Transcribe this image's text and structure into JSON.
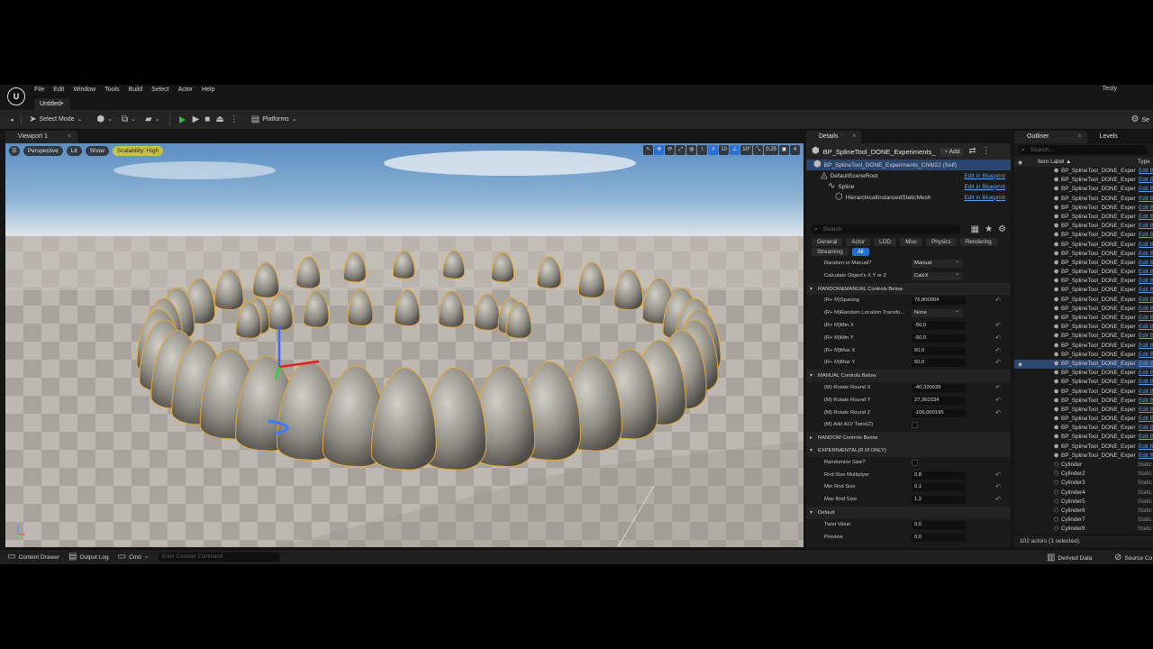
{
  "menu": {
    "items": [
      "File",
      "Edit",
      "Window",
      "Tools",
      "Build",
      "Select",
      "Actor",
      "Help"
    ]
  },
  "user": "Testy",
  "document_tab": "Untitled•",
  "toolbar": {
    "select_mode": "Select Mode",
    "platforms": "Platforms",
    "settings": "Se"
  },
  "viewport": {
    "tab": "Viewport 1",
    "perspective": "Perspective",
    "lit": "Lit",
    "show": "Show",
    "scalability": "Scalability: High",
    "grid": "10",
    "angle": "10°",
    "scale": "0.25",
    "camera": "4"
  },
  "details": {
    "tab": "Details",
    "actor_name": "BP_SplineTool_DONE_Experiments_",
    "add": "Add",
    "self_label": "BP_SplineTool_DONE_Experiments_Child22 (Self)",
    "components": [
      {
        "name": "DefaultSceneRoot",
        "action": "Edit in Blueprint"
      },
      {
        "name": "Spline",
        "action": "Edit in Blueprint"
      },
      {
        "name": "HierarchicalInstancedStaticMesh",
        "action": "Edit in Blueprint"
      }
    ],
    "search_placeholder": "Search",
    "categories": [
      "General",
      "Actor",
      "LOD",
      "Misc",
      "Physics",
      "Rendering"
    ],
    "categories2": [
      "Streaming",
      "All"
    ],
    "properties": [
      {
        "type": "prop",
        "label": "Random or Manual?",
        "value": "Manual",
        "dropdown": true
      },
      {
        "type": "prop",
        "label": "Calculate Object's X Y or Z",
        "value": "CalcX",
        "dropdown": true
      },
      {
        "type": "sect",
        "label": "RANDOM&MANUAL Controls Below"
      },
      {
        "type": "prop",
        "label": "(R+ M)Spacing",
        "value": "76,800004",
        "reset": true
      },
      {
        "type": "prop",
        "label": "(R+ M)Random Location Transfo...",
        "value": "None",
        "dropdown": true
      },
      {
        "type": "prop",
        "label": "(R+ M)Min X",
        "value": "-50,0",
        "reset": true
      },
      {
        "type": "prop",
        "label": "(R+ M)Min Y",
        "value": "-50,0",
        "reset": true
      },
      {
        "type": "prop",
        "label": "(R+ M)Max X",
        "value": "50,0",
        "reset": true
      },
      {
        "type": "prop",
        "label": "(R+ M)Max Y",
        "value": "50,0",
        "reset": true
      },
      {
        "type": "sect",
        "label": "MANUAL Controls Below"
      },
      {
        "type": "prop",
        "label": "(M) Rotate Round X",
        "value": "-40,320039",
        "reset": true
      },
      {
        "type": "prop",
        "label": "(M) Rotate Round Y",
        "value": "27,360334",
        "reset": true
      },
      {
        "type": "prop",
        "label": "(M) Rotate Round Z",
        "value": "-106,000195",
        "reset": true
      },
      {
        "type": "prop",
        "label": "(M) Add ALV Twist(Z)",
        "check": true
      },
      {
        "type": "sect",
        "label": "RANDOM Controls Below",
        "collapsed": true
      },
      {
        "type": "sect",
        "label": "EXPERIMENTAL(R M ONLY)"
      },
      {
        "type": "prop",
        "label": "Randomize Size?",
        "check": true
      },
      {
        "type": "prop",
        "label": "Rnd Size Multiplyer",
        "value": "0,8",
        "reset": true
      },
      {
        "type": "prop",
        "label": "Min Rnd Size",
        "value": "0,1",
        "reset": true
      },
      {
        "type": "prop",
        "label": "Max Rnd Size",
        "value": "1,2",
        "reset": true
      },
      {
        "type": "sect",
        "label": "Default"
      },
      {
        "type": "prop",
        "label": "Twist Value",
        "value": "0,0"
      },
      {
        "type": "prop",
        "label": "Preview",
        "value": "0,0"
      }
    ]
  },
  "outliner": {
    "tab": "Outliner",
    "tab2": "Levels",
    "search_placeholder": "Search...",
    "col_label": "Item Label ▲",
    "col_type": "Type",
    "rows": [
      {
        "label": "BP_SplineTool_DONE_Exper",
        "type": "Edit B"
      },
      {
        "label": "BP_SplineTool_DONE_Exper",
        "type": "Edit B"
      },
      {
        "label": "BP_SplineTool_DONE_Exper",
        "type": "Edit B"
      },
      {
        "label": "BP_SplineTool_DONE_Exper",
        "type": "Edit B"
      },
      {
        "label": "BP_SplineTool_DONE_Exper",
        "type": "Edit B"
      },
      {
        "label": "BP_SplineTool_DONE_Exper",
        "type": "Edit B"
      },
      {
        "label": "BP_SplineTool_DONE_Exper",
        "type": "Edit B"
      },
      {
        "label": "BP_SplineTool_DONE_Exper",
        "type": "Edit B"
      },
      {
        "label": "BP_SplineTool_DONE_Exper",
        "type": "Edit B"
      },
      {
        "label": "BP_SplineTool_DONE_Exper",
        "type": "Edit B"
      },
      {
        "label": "BP_SplineTool_DONE_Exper",
        "type": "Edit B"
      },
      {
        "label": "BP_SplineTool_DONE_Exper",
        "type": "Edit B"
      },
      {
        "label": "BP_SplineTool_DONE_Exper",
        "type": "Edit B"
      },
      {
        "label": "BP_SplineTool_DONE_Exper",
        "type": "Edit B"
      },
      {
        "label": "BP_SplineTool_DONE_Exper",
        "type": "Edit B"
      },
      {
        "label": "BP_SplineTool_DONE_Exper",
        "type": "Edit B"
      },
      {
        "label": "BP_SplineTool_DONE_Exper",
        "type": "Edit B"
      },
      {
        "label": "BP_SplineTool_DONE_Exper",
        "type": "Edit B"
      },
      {
        "label": "BP_SplineTool_DONE_Exper",
        "type": "Edit B"
      },
      {
        "label": "BP_SplineTool_DONE_Exper",
        "type": "Edit B"
      },
      {
        "label": "BP_SplineTool_DONE_Exper",
        "type": "Edit B"
      },
      {
        "label": "BP_SplineTool_DONE_Exper",
        "type": "Edit B",
        "selected": true
      },
      {
        "label": "BP_SplineTool_DONE_Exper",
        "type": "Edit B"
      },
      {
        "label": "BP_SplineTool_DONE_Exper",
        "type": "Edit B"
      },
      {
        "label": "BP_SplineTool_DONE_Exper",
        "type": "Edit B"
      },
      {
        "label": "BP_SplineTool_DONE_Exper",
        "type": "Edit B"
      },
      {
        "label": "BP_SplineTool_DONE_Exper",
        "type": "Edit B"
      },
      {
        "label": "BP_SplineTool_DONE_Exper",
        "type": "Edit B"
      },
      {
        "label": "BP_SplineTool_DONE_Exper",
        "type": "Edit B"
      },
      {
        "label": "BP_SplineTool_DONE_Exper",
        "type": "Edit B"
      },
      {
        "label": "BP_SplineTool_DONE_Exper",
        "type": "Edit B"
      },
      {
        "label": "BP_SplineTool_DONE_Exper",
        "type": "Edit B"
      },
      {
        "label": "Cylinder",
        "type": "Static"
      },
      {
        "label": "Cylinder2",
        "type": "Static"
      },
      {
        "label": "Cylinder3",
        "type": "Static"
      },
      {
        "label": "Cylinder4",
        "type": "Static"
      },
      {
        "label": "Cylinder5",
        "type": "Static"
      },
      {
        "label": "Cylinder6",
        "type": "Static"
      },
      {
        "label": "Cylinder7",
        "type": "Static"
      },
      {
        "label": "Cylinder8",
        "type": "Static"
      }
    ],
    "footer": "102 actors (1 selected)"
  },
  "statusbar": {
    "content_drawer": "Content Drawer",
    "output_log": "Output Log",
    "cmd": "Cmd",
    "console_placeholder": "Enter Console Command",
    "derived_data": "Derived Data",
    "source_control": "Source Co"
  },
  "colors": {
    "accent": "#1e6fd0",
    "selection": "#2a4670",
    "play": "#2fbd36",
    "link": "#5fa2f0",
    "scalability": "#c7c14a",
    "outline": "#e7a73a"
  }
}
